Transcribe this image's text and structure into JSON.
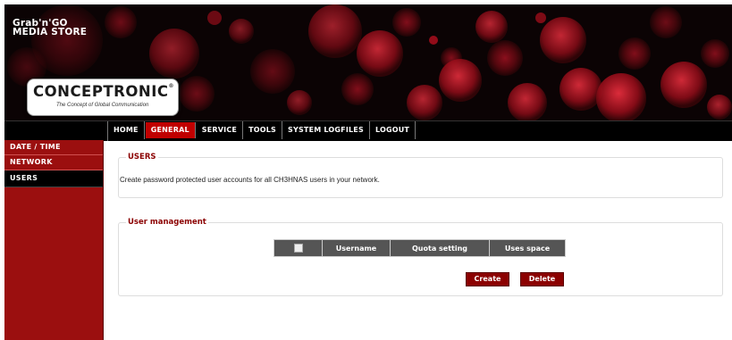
{
  "header": {
    "brand_line1": "Grab'n'GO",
    "brand_line2": "MEDIA STORE",
    "logo_text": "CONCEPTRONIC",
    "logo_registered": "®",
    "logo_tagline": "The Concept of Global Communication"
  },
  "nav": {
    "items": [
      {
        "label": "HOME"
      },
      {
        "label": "GENERAL"
      },
      {
        "label": "SERVICE"
      },
      {
        "label": "TOOLS"
      },
      {
        "label": "SYSTEM LOGFILES"
      },
      {
        "label": "LOGOUT"
      }
    ],
    "active": "GENERAL"
  },
  "sidebar": {
    "items": [
      {
        "label": "DATE / TIME"
      },
      {
        "label": "NETWORK"
      },
      {
        "label": "USERS"
      }
    ],
    "active": "USERS"
  },
  "users_section": {
    "title": "USERS",
    "description": "Create password protected user accounts for all CH3HNAS users in your network."
  },
  "user_management": {
    "title": "User management",
    "columns": [
      "Username",
      "Quota setting",
      "Uses space"
    ],
    "create_label": "Create",
    "delete_label": "Delete"
  },
  "colors": {
    "accent": "#8b0000",
    "sidebar": "#9b0f0f",
    "nav_active": "#c00000",
    "table_header": "#555555"
  }
}
